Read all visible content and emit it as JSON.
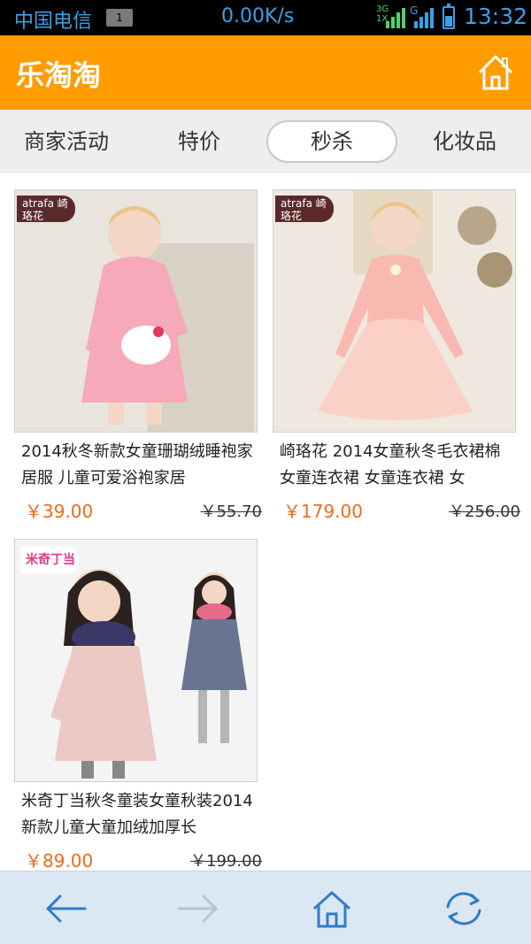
{
  "status": {
    "carrier": "中国电信",
    "sim_badge": "1",
    "speed": "0.00K/s",
    "net_top": "3G",
    "net_bottom": "1X",
    "net_g": "G",
    "time": "13:32"
  },
  "app": {
    "title": "乐淘淘",
    "accent": "#ff9c00",
    "home_icon": "home-icon"
  },
  "tabs": [
    {
      "label": "商家活动",
      "active": false
    },
    {
      "label": "特价",
      "active": false
    },
    {
      "label": "秒杀",
      "active": true
    },
    {
      "label": "化妆品",
      "active": false
    }
  ],
  "products": [
    {
      "brand": "atrafa 崎珞花",
      "name": "2014秋冬新款女童珊瑚绒睡袍家居服 儿童可爱浴袍家居",
      "price": "￥39.00",
      "old_price": "￥55.70"
    },
    {
      "brand": "atrafa 崎珞花",
      "name": "崎珞花 2014女童秋冬毛衣裙棉 女童连衣裙 女童连衣裙 女",
      "price": "￥179.00",
      "old_price": "￥256.00"
    },
    {
      "brand": "米奇丁当",
      "name": "米奇丁当秋冬童装女童秋装2014新款儿童大童加绒加厚长",
      "price": "￥89.00",
      "old_price": "￥199.00"
    }
  ],
  "bottom_nav": [
    {
      "icon": "back-arrow-icon"
    },
    {
      "icon": "forward-arrow-icon"
    },
    {
      "icon": "home-icon"
    },
    {
      "icon": "refresh-icon"
    }
  ]
}
